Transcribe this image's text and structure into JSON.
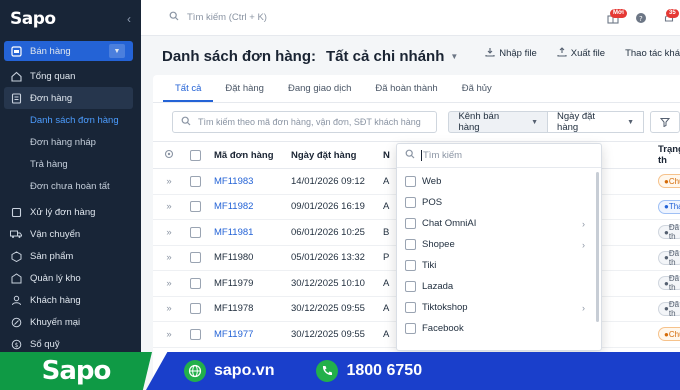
{
  "sidebar": {
    "logo": "Sapo",
    "collapse": "‹",
    "sales_channel": "Bán hàng",
    "items": [
      {
        "label": "Tổng quan",
        "icon": "home-icon"
      },
      {
        "label": "Đơn hàng",
        "icon": "orders-icon"
      }
    ],
    "order_subitems": [
      {
        "label": "Danh sách đơn hàng"
      },
      {
        "label": "Đơn hàng nháp"
      },
      {
        "label": "Trả hàng"
      },
      {
        "label": "Đơn chưa hoàn tất"
      }
    ],
    "more_items": [
      {
        "label": "Xử lý đơn hàng",
        "icon": "process-icon"
      },
      {
        "label": "Vận chuyển",
        "icon": "truck-icon"
      },
      {
        "label": "Sản phẩm",
        "icon": "product-icon"
      },
      {
        "label": "Quản lý kho",
        "icon": "warehouse-icon"
      },
      {
        "label": "Khách hàng",
        "icon": "customer-icon"
      },
      {
        "label": "Khuyến mại",
        "icon": "promo-icon"
      },
      {
        "label": "Sổ quỹ",
        "icon": "cashbook-icon"
      }
    ]
  },
  "topbar": {
    "search_placeholder": "Tìm kiếm (Ctrl + K)",
    "new_badge": "Mới",
    "notif_count": "35"
  },
  "header": {
    "title": "Danh sách đơn hàng:",
    "branch": "Tất cả chi nhánh",
    "import": "Nhập file",
    "export": "Xuất file",
    "more": "Thao tác khá"
  },
  "tabs": [
    "Tất cả",
    "Đặt hàng",
    "Đang giao dịch",
    "Đã hoàn thành",
    "Đã hủy"
  ],
  "filters": {
    "search_placeholder": "Tìm kiếm theo mã đơn hàng, vận đơn, SĐT khách hàng",
    "channel": "Kênh bán hàng",
    "date": "Ngày đặt hàng"
  },
  "table": {
    "headers": {
      "code": "Mã đơn hàng",
      "date": "Ngày đặt hàng",
      "col3": "N",
      "status": "Trạng th"
    },
    "rows": [
      {
        "code": "MF11983",
        "link": true,
        "date": "14/01/2026 09:12",
        "col3": "A",
        "status": "Chưa",
        "status_color": "orange"
      },
      {
        "code": "MF11982",
        "link": true,
        "date": "09/01/2026 16:19",
        "col3": "A",
        "status": "Thanh",
        "status_color": "blue"
      },
      {
        "code": "MF11981",
        "link": true,
        "date": "06/01/2026 10:25",
        "col3": "B",
        "status": "Đã th",
        "status_color": "gray"
      },
      {
        "code": "MF11980",
        "link": false,
        "date": "05/01/2026 13:32",
        "col3": "P",
        "status": "Đã th",
        "status_color": "gray"
      },
      {
        "code": "MF11979",
        "link": false,
        "date": "30/12/2025 10:10",
        "col3": "A",
        "status": "Đã th",
        "status_color": "gray"
      },
      {
        "code": "MF11978",
        "link": false,
        "date": "30/12/2025 09:55",
        "col3": "A",
        "status": "Đã th",
        "status_color": "gray"
      },
      {
        "code": "MF11977",
        "link": true,
        "date": "30/12/2025 09:55",
        "col3": "A",
        "status": "Chưa",
        "status_color": "orange"
      }
    ]
  },
  "channel_dropdown": {
    "search_placeholder": "Tìm kiếm",
    "options": [
      {
        "label": "Web",
        "submenu": false
      },
      {
        "label": "POS",
        "submenu": false
      },
      {
        "label": "Chat OmniAI",
        "submenu": true
      },
      {
        "label": "Shopee",
        "submenu": true
      },
      {
        "label": "Tiki",
        "submenu": false
      },
      {
        "label": "Lazada",
        "submenu": false
      },
      {
        "label": "Tiktokshop",
        "submenu": true
      },
      {
        "label": "Facebook",
        "submenu": false
      }
    ]
  },
  "banner": {
    "logo": "Sapo",
    "website": "sapo.vn",
    "hotline": "1800 6750"
  },
  "colors": {
    "sidebar": "#182537",
    "accent": "#2463d6",
    "banner_green": "#0f9a45",
    "banner_blue": "#1a3fcb"
  }
}
